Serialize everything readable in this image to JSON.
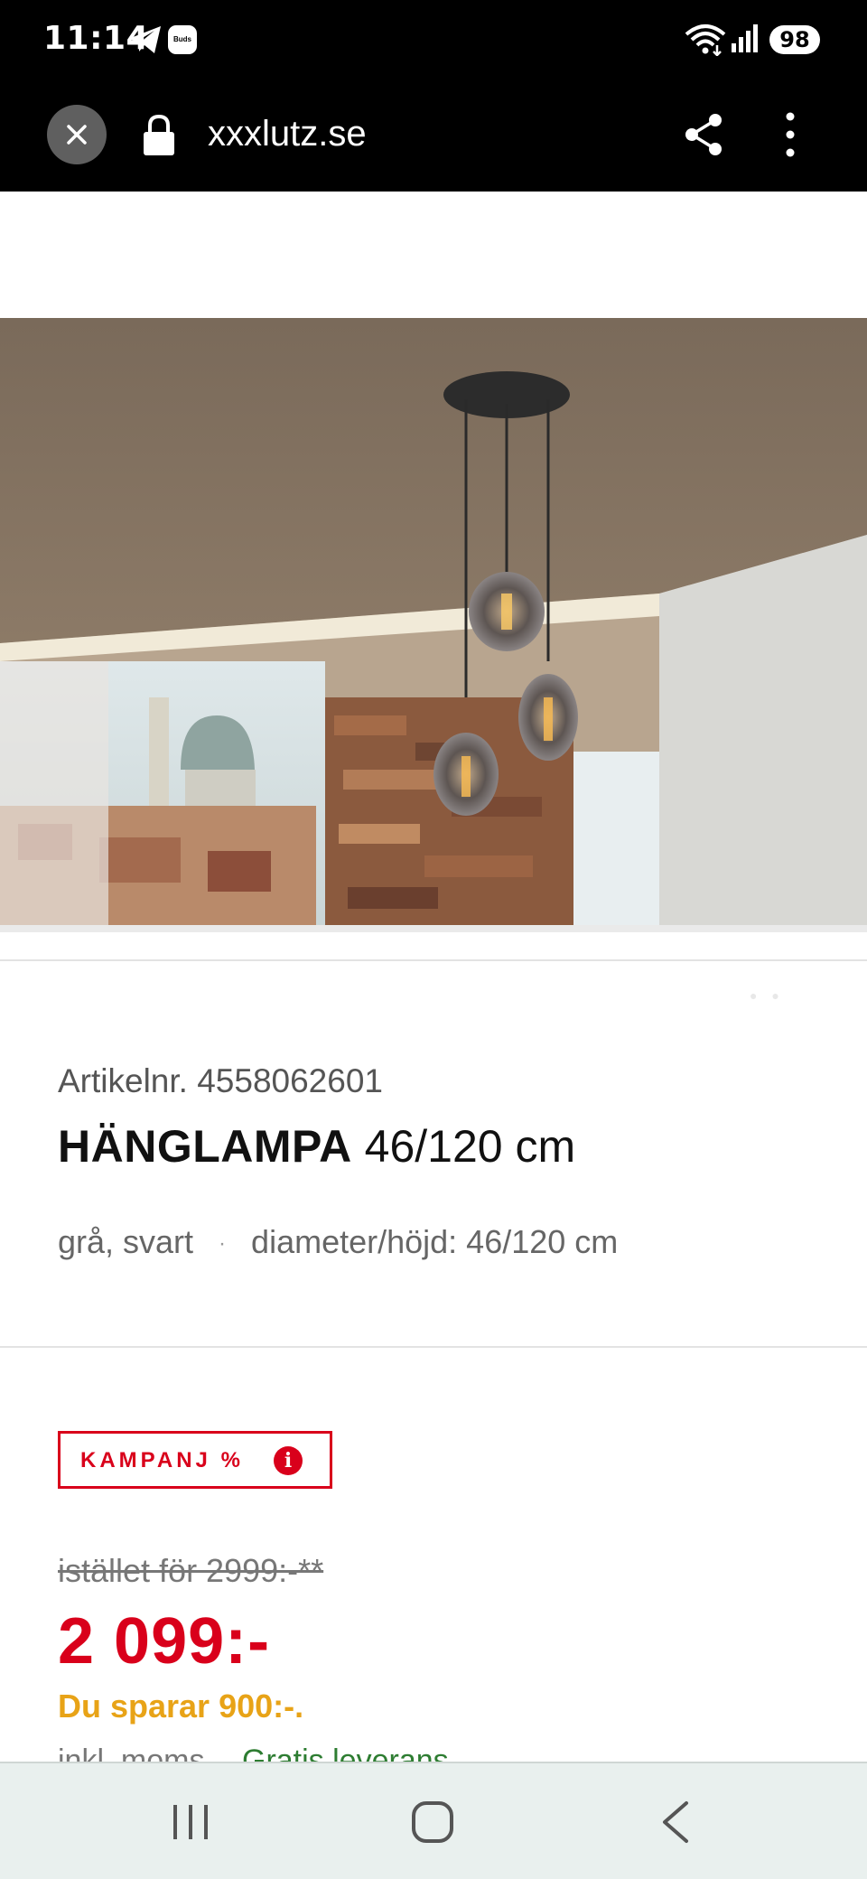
{
  "status_bar": {
    "time": "11:14",
    "buds_label": "Buds",
    "battery": "98"
  },
  "browser": {
    "url": "xxxlutz.se",
    "icons": [
      "close-icon",
      "lock-icon",
      "share-icon",
      "more-vert-icon"
    ]
  },
  "product": {
    "image_alt": "HÄNGLAMPA 46/120 cm",
    "article_label": "Artikelnr.",
    "article_number": "4558062601",
    "name": "HÄNGLAMPA",
    "size": "46/120 cm",
    "color": "grå, svart",
    "separator": "·",
    "dimensions": "diameter/höjd: 46/120 cm"
  },
  "pricing": {
    "badge_label": "KAMPANJ %",
    "info_icon": "i",
    "old_price": "istället för 2999:-**",
    "new_price": "2 099:-",
    "savings": "Du sparar 900:-.",
    "vat_note": "inkl. moms",
    "delivery": "Gratis leverans"
  },
  "colors": {
    "accent_red": "#d9001b",
    "savings_yellow": "#e8a317",
    "delivery_green": "#2e7d32"
  },
  "nav": {
    "icons": [
      "recent-apps-icon",
      "home-icon",
      "back-icon"
    ]
  }
}
